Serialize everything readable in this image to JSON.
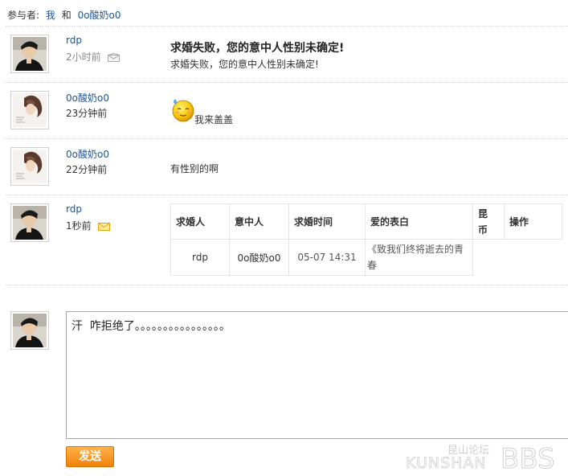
{
  "participants": {
    "label": "参与者:",
    "me": "我",
    "and": "和",
    "other": "0o酸奶o0"
  },
  "messages": [
    {
      "user": "rdp",
      "time": "2小时前",
      "title": "求婚失败，您的意中人性别未确定!",
      "body": "求婚失败，您的意中人性别未确定!"
    },
    {
      "user": "0o酸奶o0",
      "time": "23分钟前",
      "body": "我来盖盖"
    },
    {
      "user": "0o酸奶o0",
      "time": "22分钟前",
      "body": "有性别的啊"
    },
    {
      "user": "rdp",
      "time": "1秒前"
    }
  ],
  "proposal_table": {
    "headers": [
      "求婚人",
      "意中人",
      "求婚时间",
      "爱的表白",
      "昆币",
      "操作"
    ],
    "row": [
      "rdp",
      "0o酸奶o0",
      "05-07 14:31",
      "《致我们终将逝去的青春",
      "",
      ""
    ]
  },
  "reply": {
    "value": "汗  咋拒绝了。。。。。。。。。。。。。。。。",
    "send_label": "发送"
  },
  "watermark": {
    "cn": "昆山论坛",
    "en": "KUNSHAN",
    "bbs": "BBS"
  },
  "colors": {
    "link": "#1e5494",
    "button": "#f0820c"
  }
}
